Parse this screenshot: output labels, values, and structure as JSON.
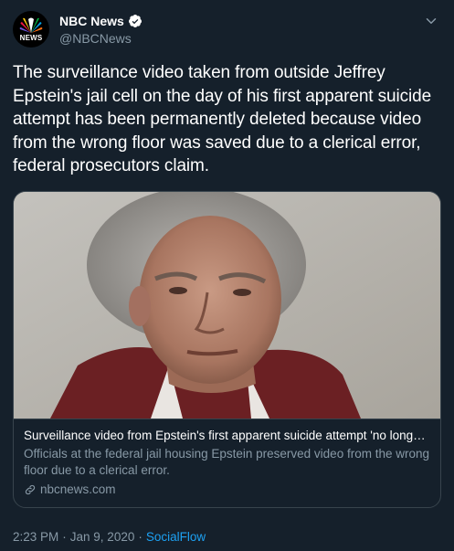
{
  "account": {
    "display_name": "NBC News",
    "handle": "@NBCNews",
    "avatar_text": "NEWS",
    "verified": true
  },
  "tweet": {
    "text": "The surveillance video taken from outside Jeffrey Epstein's jail cell on the day of his first apparent suicide attempt has been permanently deleted because video from the wrong floor was saved due to a clerical error, federal prosecutors claim."
  },
  "card": {
    "title": "Surveillance video from Epstein's first apparent suicide attempt 'no longer e...",
    "description": "Officials at the federal jail housing Epstein preserved video from the wrong floor due to a clerical error.",
    "domain": "nbcnews.com",
    "link_icon": "link-icon"
  },
  "meta": {
    "time": "2:23 PM",
    "separator": "·",
    "date": "Jan 9, 2020",
    "source": "SocialFlow"
  },
  "colors": {
    "background": "#15202b",
    "border": "#38444d",
    "secondary_text": "#8899a6",
    "accent": "#1da1f2"
  }
}
